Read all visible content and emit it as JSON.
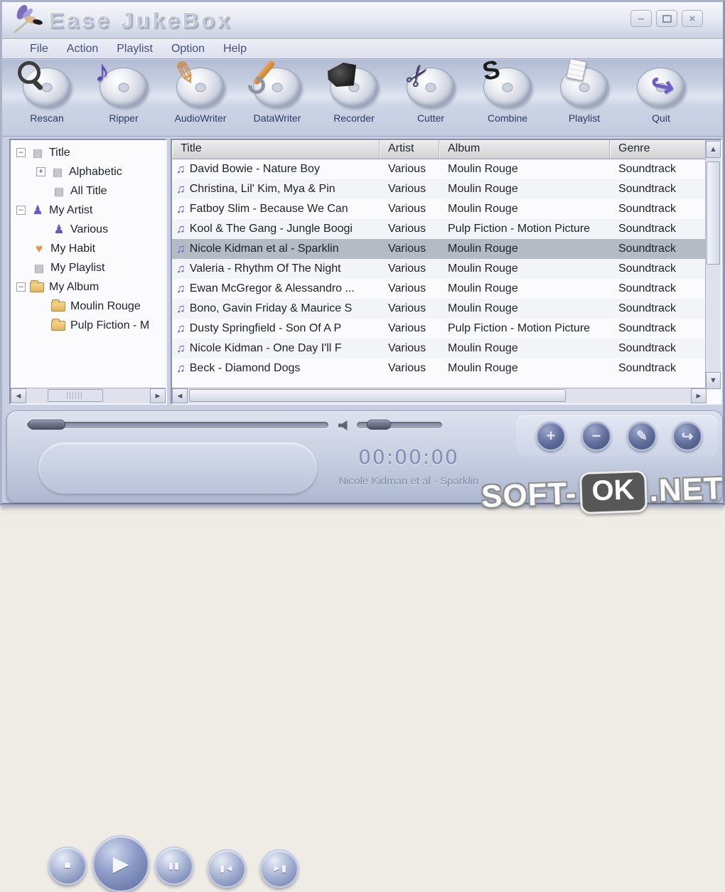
{
  "window": {
    "title": "Ease JukeBox"
  },
  "icons": {
    "minimize": "–",
    "close": "×",
    "arrow_up": "▲",
    "arrow_down": "▼",
    "arrow_left": "◄",
    "arrow_right": "►",
    "expander_open": "–",
    "expander_closed": "+",
    "note_single": "♪",
    "note_double": "♫",
    "scissors": "✂",
    "chain": "S",
    "quit_arrow": "↪",
    "tree_grid": "▤",
    "tree_artist": "♟",
    "tree_heart": "♥",
    "stop": "■",
    "play": "▶",
    "pause": "▮▮",
    "prev": "▮◄",
    "next": "►▮",
    "plus": "+",
    "minus": "−",
    "edit": "✎",
    "exit": "↪"
  },
  "menu": {
    "items": [
      "File",
      "Action",
      "Playlist",
      "Option",
      "Help"
    ]
  },
  "toolbar": {
    "items": [
      {
        "label": "Rescan"
      },
      {
        "label": "Ripper"
      },
      {
        "label": "AudioWriter"
      },
      {
        "label": "DataWriter"
      },
      {
        "label": "Recorder"
      },
      {
        "label": "Cutter"
      },
      {
        "label": "Combine"
      },
      {
        "label": "Playlist"
      },
      {
        "label": "Quit"
      }
    ]
  },
  "tree": {
    "items": [
      {
        "label": "Title"
      },
      {
        "label": "Alphabetic"
      },
      {
        "label": "All Title"
      },
      {
        "label": "My Artist"
      },
      {
        "label": "Various"
      },
      {
        "label": "My Habit"
      },
      {
        "label": "My Playlist"
      },
      {
        "label": "My Album"
      },
      {
        "label": "Moulin Rouge"
      },
      {
        "label": "Pulp Fiction - M"
      }
    ]
  },
  "table": {
    "headers": [
      "Title",
      "Artist",
      "Album",
      "Genre"
    ],
    "selected_index": 4,
    "rows": [
      {
        "title": "David Bowie - Nature Boy",
        "artist": "Various",
        "album": "Moulin Rouge",
        "genre": "Soundtrack"
      },
      {
        "title": "Christina, Lil' Kim, Mya & Pin",
        "artist": "Various",
        "album": "Moulin Rouge",
        "genre": "Soundtrack"
      },
      {
        "title": "Fatboy Slim - Because We Can",
        "artist": "Various",
        "album": "Moulin Rouge",
        "genre": "Soundtrack"
      },
      {
        "title": "Kool & The Gang - Jungle Boogi",
        "artist": "Various",
        "album": "Pulp Fiction - Motion Picture",
        "genre": "Soundtrack"
      },
      {
        "title": "Nicole Kidman et al - Sparklin",
        "artist": "Various",
        "album": "Moulin Rouge",
        "genre": "Soundtrack"
      },
      {
        "title": "Valeria - Rhythm Of The Night",
        "artist": "Various",
        "album": "Moulin Rouge",
        "genre": "Soundtrack"
      },
      {
        "title": "Ewan McGregor & Alessandro ...",
        "artist": "Various",
        "album": "Moulin Rouge",
        "genre": "Soundtrack"
      },
      {
        "title": "Bono, Gavin Friday & Maurice S",
        "artist": "Various",
        "album": "Moulin Rouge",
        "genre": "Soundtrack"
      },
      {
        "title": "Dusty Springfield - Son Of A P",
        "artist": "Various",
        "album": "Pulp Fiction - Motion Picture",
        "genre": "Soundtrack"
      },
      {
        "title": "Nicole Kidman - One Day I'll F",
        "artist": "Various",
        "album": "Moulin Rouge",
        "genre": "Soundtrack"
      },
      {
        "title": "Beck - Diamond Dogs",
        "artist": "Various",
        "album": "Moulin Rouge",
        "genre": "Soundtrack"
      }
    ]
  },
  "player": {
    "time": "00:00:00",
    "track": "Nicole Kidman et al - Sparklin"
  },
  "watermark": {
    "prefix": "SOFT-",
    "ok": "OK",
    "suffix": ".NET"
  },
  "colors": {
    "accent_purple": "#6a58c4",
    "selection_gray": "#b5bbc4",
    "panel_blue": "#c9cfe2"
  }
}
